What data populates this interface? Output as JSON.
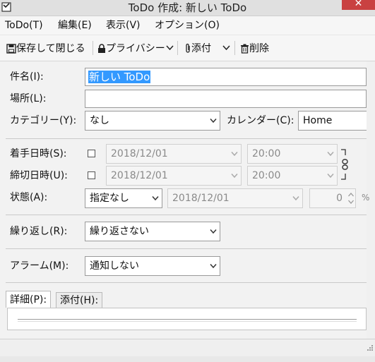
{
  "window": {
    "title": "ToDo 作成: 新しい ToDo",
    "close_glyph": "✕"
  },
  "menu": [
    {
      "label": "ToDo(T)"
    },
    {
      "label": "編集(E)"
    },
    {
      "label": "表示(V)"
    },
    {
      "label": "オプション(O)"
    }
  ],
  "toolbar": {
    "save_close": "保存して閉じる",
    "privacy": "プライバシー",
    "attach": "添付",
    "delete": "削除"
  },
  "form": {
    "title_label": "件名(I):",
    "title_value": "新しい ToDo",
    "location_label": "場所(L):",
    "location_value": "",
    "category_label": "カテゴリー(Y):",
    "category_value": "なし",
    "calendar_label": "カレンダー(C):",
    "calendar_value": "Home",
    "start_label": "着手日時(S):",
    "start_date": "2018/12/01",
    "start_time": "20:00",
    "due_label": "締切日時(U):",
    "due_date": "2018/12/01",
    "due_time": "20:00",
    "status_label": "状態(A):",
    "status_value": "指定なし",
    "status_date": "2018/12/01",
    "percent_value": "0",
    "percent_unit": "%",
    "repeat_label": "繰り返し(R):",
    "repeat_value": "繰り返さない",
    "alarm_label": "アラーム(M):",
    "alarm_value": "通知しない"
  },
  "tabs": {
    "details": "詳細(P):",
    "attachments": "添付(H):"
  },
  "colors": {
    "selection": "#3399ff",
    "close_button": "#c94141"
  }
}
